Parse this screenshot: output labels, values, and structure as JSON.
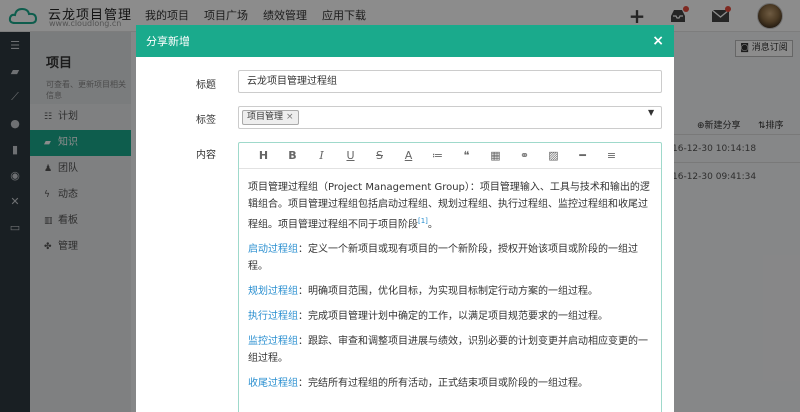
{
  "header": {
    "logo_title": "云龙项目管理",
    "logo_sub": "www.cloudlong.cn",
    "nav": [
      "我的项目",
      "项目广场",
      "绩效管理",
      "应用下载"
    ]
  },
  "iconbar": {
    "icons": [
      "menu-icon",
      "folder-icon",
      "chart-icon",
      "globe-icon",
      "chat-icon",
      "palette-icon",
      "tools-icon",
      "monitor-icon"
    ]
  },
  "sidebar": {
    "title": "项目",
    "desc": "可查看、更新项目相关信息",
    "items": [
      {
        "label": "计划",
        "active": false
      },
      {
        "label": "知识",
        "active": true
      },
      {
        "label": "团队",
        "active": false
      },
      {
        "label": "动态",
        "active": false
      },
      {
        "label": "看板",
        "active": false
      },
      {
        "label": "管理",
        "active": false
      }
    ]
  },
  "background": {
    "subscribe_label": "消息订阅",
    "new_share_label": "新建分享",
    "sort_label": "排序",
    "times": [
      "16-12-30 10:14:18",
      "16-12-30 09:41:34"
    ]
  },
  "modal": {
    "title": "分享新增",
    "close_label": "×",
    "title_label": "标题",
    "title_value": "云龙项目管理过程组",
    "tag_label": "标签",
    "tag_value": "项目管理",
    "content_label": "内容",
    "toolbar": [
      "H",
      "B",
      "I",
      "U",
      "S",
      "A",
      "≔",
      "❝",
      "▦",
      "⚭",
      "▨",
      "━",
      "≡"
    ],
    "content": {
      "intro": "项目管理过程组（Project Management Group）：项目管理输入、工具与技术和输出的逻辑组合。项目管理过程组包括启动过程组、规划过程组、执行过程组、监控过程组和收尾过程组。项目管理过程组不同于项目阶段",
      "ref": "[1]",
      "intro_end": "。",
      "groups": [
        {
          "name": "启动过程组",
          "desc": "：定义一个新项目或现有项目的一个新阶段，授权开始该项目或阶段的一组过程。"
        },
        {
          "name": "规划过程组",
          "desc": "：明确项目范围，优化目标，为实现目标制定行动方案的一组过程。"
        },
        {
          "name": "执行过程组",
          "desc": "：完成项目管理计划中确定的工作，以满足项目规范要求的一组过程。"
        },
        {
          "name": "监控过程组",
          "desc": "：跟踪、审查和调整项目进展与绩效，识别必要的计划变更并启动相应变更的一组过程。"
        },
        {
          "name": "收尾过程组",
          "desc": "：完结所有过程组的所有活动，正式结束项目或阶段的一组过程。"
        }
      ]
    }
  },
  "colors": {
    "accent": "#1aaa8c",
    "link": "#2a8fd0",
    "iconbar": "#2f3940"
  }
}
